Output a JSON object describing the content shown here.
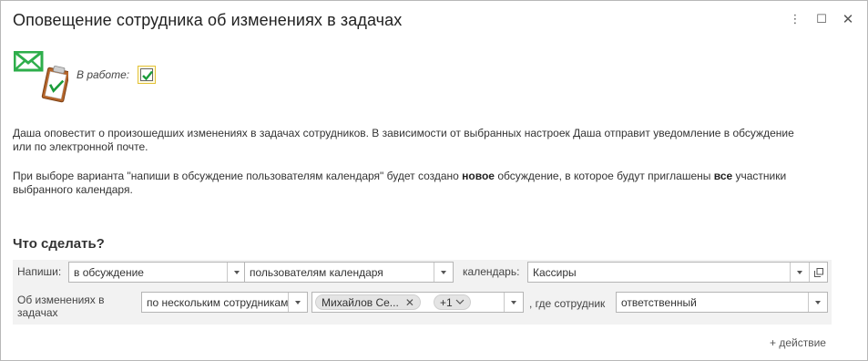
{
  "window": {
    "title": "Оповещение сотрудника об изменениях в задачах",
    "controls": {
      "more": "⋮",
      "maximize": "☐",
      "close": "✕"
    }
  },
  "status": {
    "label": "В работе:",
    "checked": true
  },
  "description": {
    "p1": "Даша оповестит о произошедших изменениях в задачах сотрудников. В зависимости от выбранных настроек Даша отправит уведомление в обсуждение или по электронной почте.",
    "p2_part1": "При выборе варианта \"напиши в обсуждение пользователям календаря\" будет создано ",
    "p2_bold1": "новое",
    "p2_part2": " обсуждение, в которое будут приглашены ",
    "p2_bold2": "все",
    "p2_part3": " участники выбранного календаря."
  },
  "section": {
    "title": "Что сделать?"
  },
  "row1": {
    "label": "Напиши:",
    "where_value": "в обсуждение",
    "to_value": "пользователям календаря",
    "calendar_label": "календарь:",
    "calendar_value": "Кассиры"
  },
  "row2": {
    "label": "Об изменениях в задачах",
    "mode_value": "по нескольким сотрудникам",
    "tag1": "Михайлов Се...",
    "tag_more": "+1",
    "where_label": ", где сотрудник",
    "role_value": "ответственный"
  },
  "actions": {
    "add": "+ действие"
  },
  "colors": {
    "envelope": "#2eae4b",
    "checkmark": "#1a9c3a",
    "highlight_border": "#e3c236"
  }
}
